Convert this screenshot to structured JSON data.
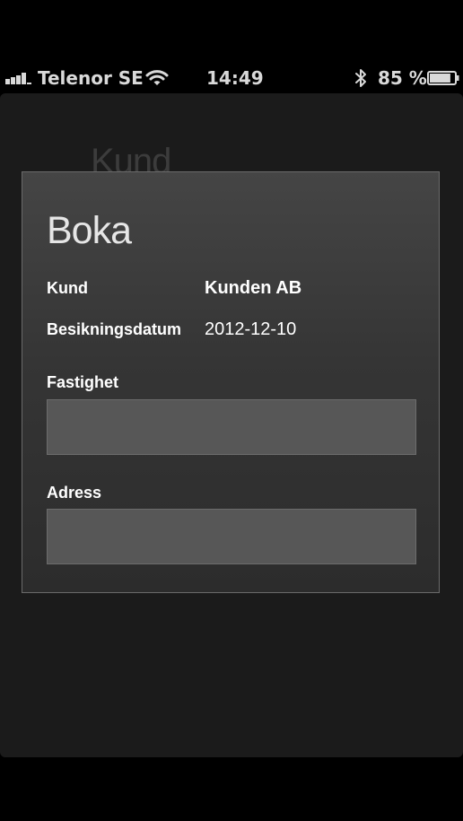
{
  "status_bar": {
    "carrier": "Telenor SE",
    "time": "14:49",
    "battery_percent": "85 %",
    "signal_bars": 4,
    "battery_level": 0.85,
    "icons": [
      "signal-icon",
      "wifi-icon",
      "bluetooth-icon",
      "battery-icon"
    ]
  },
  "background_screen": {
    "title": "Kund"
  },
  "dialog": {
    "title": "Boka",
    "customer_label": "Kund",
    "customer_value": "Kunden AB",
    "date_label": "Besikningsdatum",
    "date_value": "2012-12-10",
    "property_label": "Fastighet",
    "property_value": "",
    "address_label": "Adress",
    "address_value": ""
  },
  "colors": {
    "background": "#1b1b1b",
    "dialog_border": "#6b6b6b",
    "input_fill": "#575757",
    "text": "#ffffff"
  }
}
